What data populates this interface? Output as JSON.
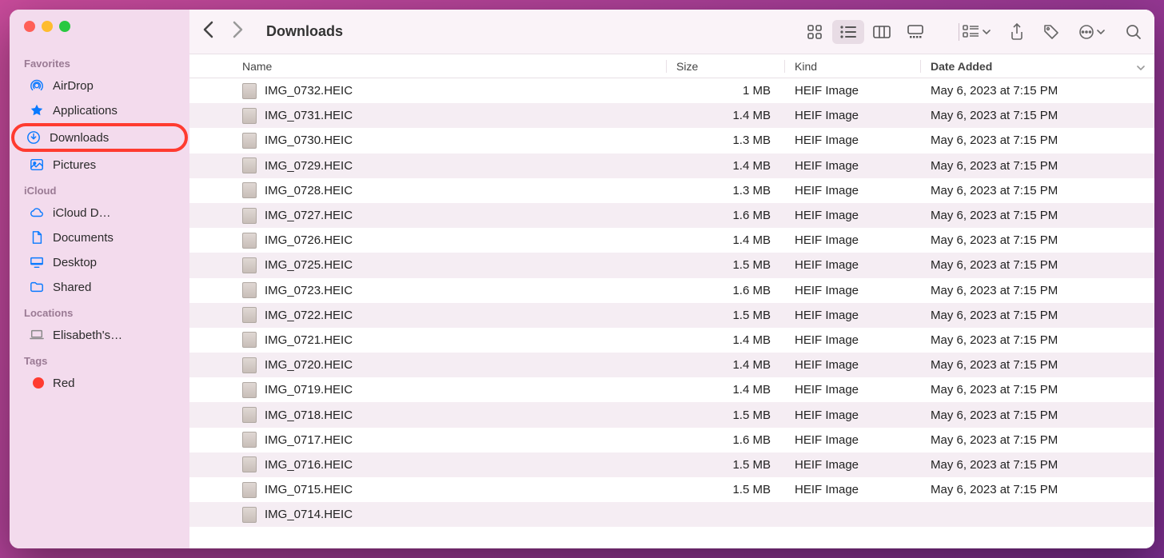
{
  "sidebar": {
    "sections": [
      {
        "title": "Favorites",
        "items": [
          {
            "label": "AirDrop",
            "icon": "airdrop"
          },
          {
            "label": "Applications",
            "icon": "applications"
          },
          {
            "label": "Downloads",
            "icon": "downloads",
            "highlighted": true
          },
          {
            "label": "Pictures",
            "icon": "pictures"
          }
        ]
      },
      {
        "title": "iCloud",
        "items": [
          {
            "label": "iCloud D…",
            "icon": "cloud"
          },
          {
            "label": "Documents",
            "icon": "documents"
          },
          {
            "label": "Desktop",
            "icon": "desktop"
          },
          {
            "label": "Shared",
            "icon": "shared"
          }
        ]
      },
      {
        "title": "Locations",
        "items": [
          {
            "label": "Elisabeth's…",
            "icon": "laptop"
          }
        ]
      },
      {
        "title": "Tags",
        "items": [
          {
            "label": "Red",
            "icon": "tag-red"
          }
        ]
      }
    ]
  },
  "toolbar": {
    "title": "Downloads"
  },
  "columns": {
    "name": "Name",
    "size": "Size",
    "kind": "Kind",
    "date": "Date Added"
  },
  "files": [
    {
      "name": "IMG_0732.HEIC",
      "size": "1 MB",
      "kind": "HEIF Image",
      "date": "May 6, 2023 at 7:15 PM"
    },
    {
      "name": "IMG_0731.HEIC",
      "size": "1.4 MB",
      "kind": "HEIF Image",
      "date": "May 6, 2023 at 7:15 PM"
    },
    {
      "name": "IMG_0730.HEIC",
      "size": "1.3 MB",
      "kind": "HEIF Image",
      "date": "May 6, 2023 at 7:15 PM"
    },
    {
      "name": "IMG_0729.HEIC",
      "size": "1.4 MB",
      "kind": "HEIF Image",
      "date": "May 6, 2023 at 7:15 PM"
    },
    {
      "name": "IMG_0728.HEIC",
      "size": "1.3 MB",
      "kind": "HEIF Image",
      "date": "May 6, 2023 at 7:15 PM"
    },
    {
      "name": "IMG_0727.HEIC",
      "size": "1.6 MB",
      "kind": "HEIF Image",
      "date": "May 6, 2023 at 7:15 PM"
    },
    {
      "name": "IMG_0726.HEIC",
      "size": "1.4 MB",
      "kind": "HEIF Image",
      "date": "May 6, 2023 at 7:15 PM"
    },
    {
      "name": "IMG_0725.HEIC",
      "size": "1.5 MB",
      "kind": "HEIF Image",
      "date": "May 6, 2023 at 7:15 PM"
    },
    {
      "name": "IMG_0723.HEIC",
      "size": "1.6 MB",
      "kind": "HEIF Image",
      "date": "May 6, 2023 at 7:15 PM"
    },
    {
      "name": "IMG_0722.HEIC",
      "size": "1.5 MB",
      "kind": "HEIF Image",
      "date": "May 6, 2023 at 7:15 PM"
    },
    {
      "name": "IMG_0721.HEIC",
      "size": "1.4 MB",
      "kind": "HEIF Image",
      "date": "May 6, 2023 at 7:15 PM"
    },
    {
      "name": "IMG_0720.HEIC",
      "size": "1.4 MB",
      "kind": "HEIF Image",
      "date": "May 6, 2023 at 7:15 PM"
    },
    {
      "name": "IMG_0719.HEIC",
      "size": "1.4 MB",
      "kind": "HEIF Image",
      "date": "May 6, 2023 at 7:15 PM"
    },
    {
      "name": "IMG_0718.HEIC",
      "size": "1.5 MB",
      "kind": "HEIF Image",
      "date": "May 6, 2023 at 7:15 PM"
    },
    {
      "name": "IMG_0717.HEIC",
      "size": "1.6 MB",
      "kind": "HEIF Image",
      "date": "May 6, 2023 at 7:15 PM"
    },
    {
      "name": "IMG_0716.HEIC",
      "size": "1.5 MB",
      "kind": "HEIF Image",
      "date": "May 6, 2023 at 7:15 PM"
    },
    {
      "name": "IMG_0715.HEIC",
      "size": "1.5 MB",
      "kind": "HEIF Image",
      "date": "May 6, 2023 at 7:15 PM"
    },
    {
      "name": "IMG_0714.HEIC",
      "size": "",
      "kind": "",
      "date": ""
    }
  ]
}
